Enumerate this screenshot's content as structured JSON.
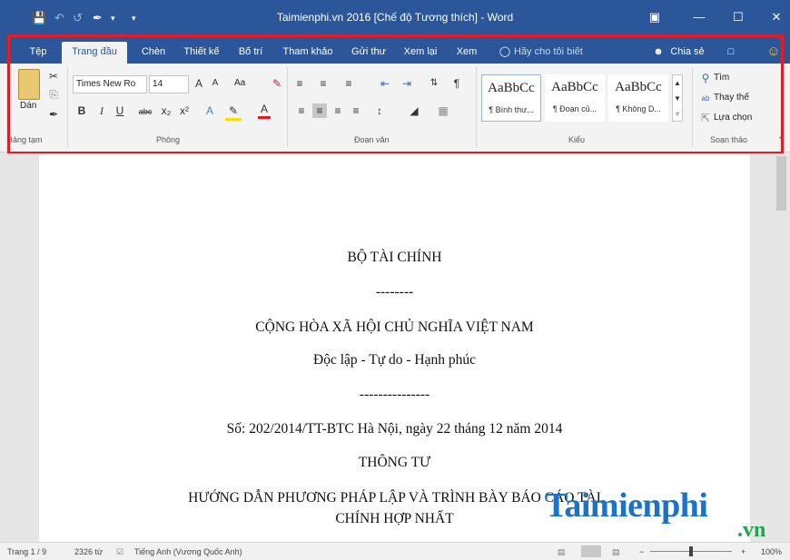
{
  "window": {
    "title": "Taimienphi.vn  2016 [Chế độ Tương thích]  -  Word",
    "icons": [
      "save-icon",
      "undo-icon",
      "redo-icon",
      "format-painter-icon",
      "ribbon-display-icon",
      "minimize-icon",
      "restore-icon",
      "close-icon"
    ]
  },
  "tabs": [
    "Tệp",
    "Trang đầu",
    "Chèn",
    "Thiết kế",
    "Bố trí",
    "Tham khảo",
    "Gửi thư",
    "Xem lại",
    "Xem"
  ],
  "tellme": "Hãy cho tôi biết",
  "share": "Chia sẻ",
  "clipboard": {
    "paste": "Dán",
    "group": "Bảng tạm"
  },
  "font": {
    "name": "Times New Ro",
    "size": "14",
    "group": "Phông",
    "case": "Aa"
  },
  "paragraph": {
    "group": "Đoạn văn"
  },
  "styles": {
    "group": "Kiểu",
    "items": [
      {
        "sample": "AaBbCc",
        "name": "¶ Bình thư..."
      },
      {
        "sample": "AaBbCc",
        "name": "¶ Đoạn củ..."
      },
      {
        "sample": "AaBbCc",
        "name": "¶ Không D..."
      }
    ]
  },
  "editing": {
    "find": "Tìm",
    "replace": "Thay thế",
    "select": "Lựa chọn",
    "group": "Soạn thảo"
  },
  "document": {
    "lines": [
      "BỘ TÀI CHÍNH",
      "--------",
      "CỘNG HÒA XÃ HỘI CHỦ NGHĨA VIỆT NAM",
      "Độc lập - Tự do - Hạnh phúc",
      "---------------",
      "Số: 202/2014/TT-BTC Hà Nội, ngày 22 tháng 12 năm 2014",
      "THÔNG TƯ",
      "HƯỚNG DẪN PHƯƠNG PHÁP LẬP VÀ TRÌNH BÀY BÁO CÁO TÀI",
      "CHÍNH HỢP NHẤT"
    ]
  },
  "status": {
    "page": "Trang 1 / 9",
    "words": "2326 từ",
    "language": "Tiếng Anh (Vương Quốc Anh)",
    "zoom": "100%"
  },
  "watermark": {
    "main": "Taimienphi",
    "suffix": ".vn"
  },
  "colors": {
    "titlebar": "#2b579a",
    "highlight_box": "#e31b23",
    "logo_blue": "#1a73c6",
    "logo_green": "#21a44a"
  }
}
